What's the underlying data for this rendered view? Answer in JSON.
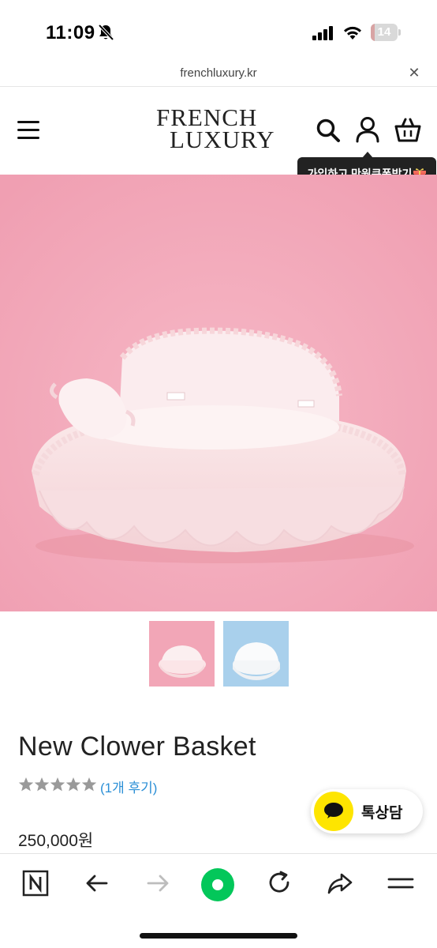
{
  "status_bar": {
    "time": "11:09",
    "battery": "14",
    "battery_percent": 14,
    "icons": [
      "bell-slash-icon",
      "signal-icon",
      "wifi-icon",
      "battery-icon"
    ]
  },
  "browser": {
    "url": "frenchluxury.kr",
    "close_symbol": "✕"
  },
  "header": {
    "logo_line1": "FRENCH",
    "logo_line2": "LUXURY",
    "icons": [
      "menu-icon",
      "search-icon",
      "user-icon",
      "cart-icon"
    ],
    "tooltip": "가입하고 만원쿠폰받기"
  },
  "product": {
    "title": "New Clower Basket",
    "rating": 5,
    "rating_max": 5,
    "review_text": "(1개 후기)",
    "price": "250,000원",
    "thumbnails": [
      "pink-background",
      "blue-background"
    ]
  },
  "chat_button": {
    "label": "톡상담",
    "icon": "kakao-chat-icon"
  },
  "toolbar": {
    "icons": [
      "naver-n-icon",
      "back-arrow-icon",
      "forward-arrow-icon",
      "green-home-icon",
      "reload-icon",
      "share-icon",
      "menu-lines-icon"
    ]
  },
  "colors": {
    "hero_pink": "#f3a9bb",
    "link_blue": "#2b8fd6",
    "kakao_yellow": "#fee500",
    "naver_green": "#03c75a",
    "tooltip_bg": "#222222"
  }
}
